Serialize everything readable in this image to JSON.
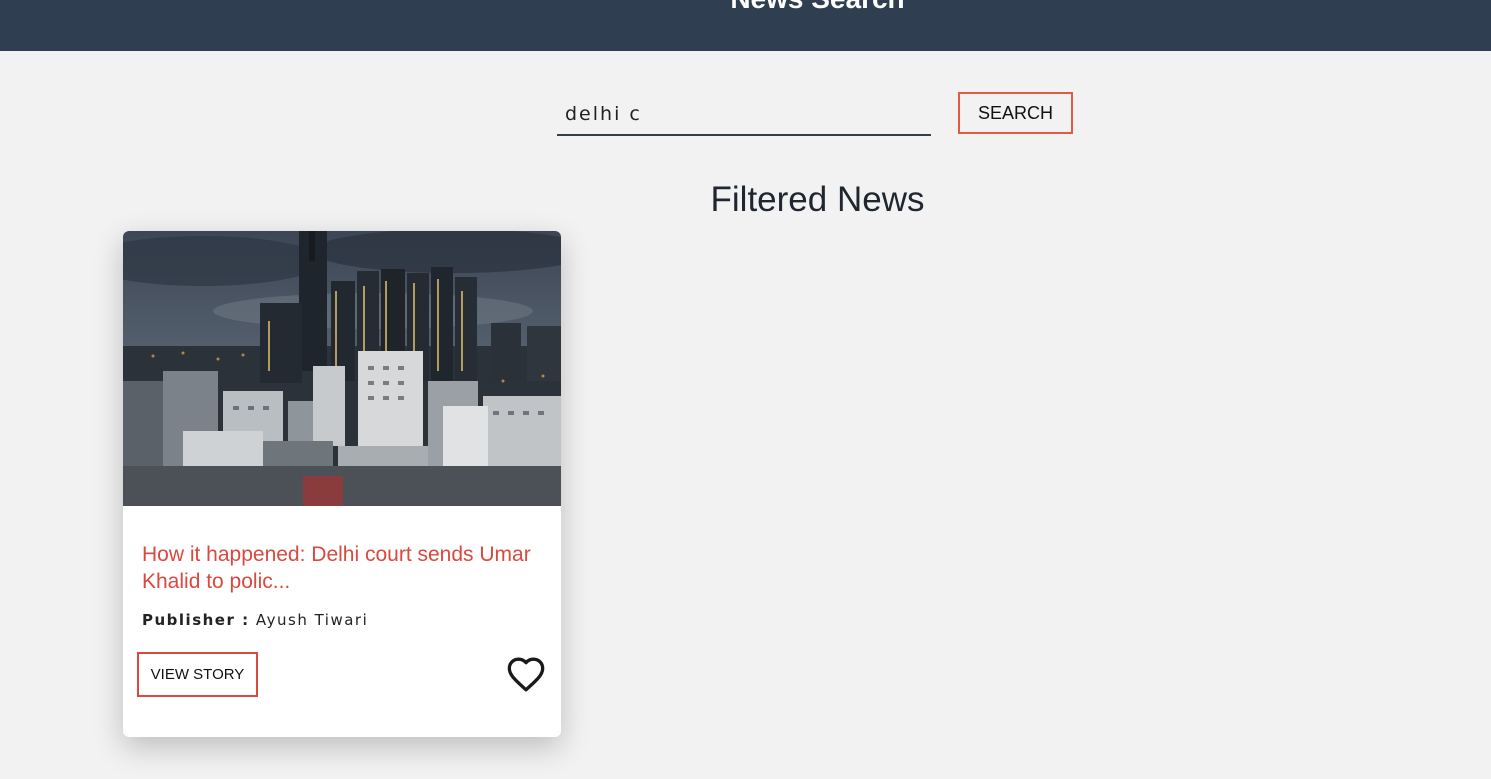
{
  "header": {
    "title": "News Search"
  },
  "search": {
    "value": "delhi c",
    "button_label": "SEARCH"
  },
  "section": {
    "title": "Filtered News"
  },
  "card": {
    "title_line1": "How it happened: Delhi court sends Umar",
    "title_line2": "Khalid to polic...",
    "publisher_label": "Publisher :",
    "publisher_name": "Ayush Tiwari",
    "view_button": "VIEW STORY",
    "image": "city-skyline-night",
    "favorite_icon": "heart-outline-icon"
  },
  "colors": {
    "header_bg": "#2f3e50",
    "accent": "#d9493f",
    "page_bg": "#f2f2f2"
  }
}
